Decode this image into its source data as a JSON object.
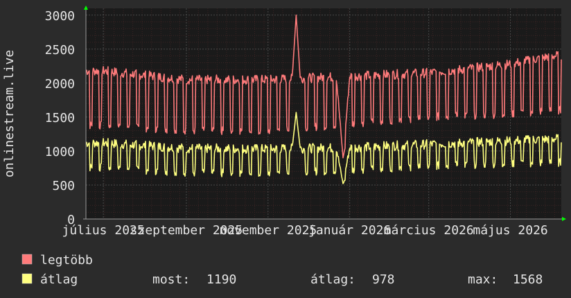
{
  "chart_data": {
    "type": "line",
    "ylabel": "onlinestream.live",
    "ylim": [
      0,
      3100
    ],
    "yticks": [
      0,
      500,
      1000,
      1500,
      2000,
      2500,
      3000
    ],
    "ytick_labels": [
      "0",
      "500",
      "1000",
      "1500",
      "2000",
      "2500",
      "3000"
    ],
    "xlim": [
      "2025-06-18",
      "2026-06-08"
    ],
    "x_tick_labels": [
      "július 2025",
      "szeptember 2025",
      "november 2025",
      "január 2026",
      "március 2026",
      "május 2026"
    ],
    "x_tick_dates": [
      "2025-07-01",
      "2025-09-01",
      "2025-11-01",
      "2026-01-01",
      "2026-03-01",
      "2026-05-01"
    ],
    "grid": true,
    "series": [
      {
        "name": "legtöbb",
        "color": "#ff7b7b",
        "weekday_level": [
          2180,
          2050,
          2050,
          2100,
          2150,
          2280,
          2400
        ],
        "weekend_level": [
          1380,
          1300,
          1300,
          1400,
          1500,
          1550,
          1600
        ],
        "peak": 3000,
        "peak_date": "2025-11-22"
      },
      {
        "name": "átlag",
        "color": "#ffff80",
        "weekday_level": [
          1120,
          1040,
          1030,
          1050,
          1100,
          1150,
          1180
        ],
        "weekend_level": [
          760,
          680,
          680,
          720,
          780,
          820,
          830
        ],
        "peak": 1568,
        "peak_date": "2025-11-22"
      }
    ],
    "level_dates": [
      "2025-07-01",
      "2025-09-01",
      "2025-11-01",
      "2026-01-01",
      "2026-03-01",
      "2026-05-01",
      "2026-06-01"
    ],
    "dip_date": "2025-12-27",
    "dip_values": {
      "legtöbb": 900,
      "átlag": 520
    }
  },
  "legend": {
    "max_label": "legtöbb",
    "avg_label": "átlag",
    "stats": {
      "now_label": "most:",
      "now_value": "1190",
      "avg_label": "átlag:",
      "avg_value": "978",
      "max_label": "max:",
      "max_value": "1568"
    }
  },
  "colors": {
    "background": "#2b2b2b",
    "plot": "#1a1a1a",
    "grid": "#4a4a4a",
    "grid_minor": "#3c2424",
    "axis": "#9a9a9a",
    "text": "#e6e6e6",
    "arrow": "#00ff00"
  }
}
